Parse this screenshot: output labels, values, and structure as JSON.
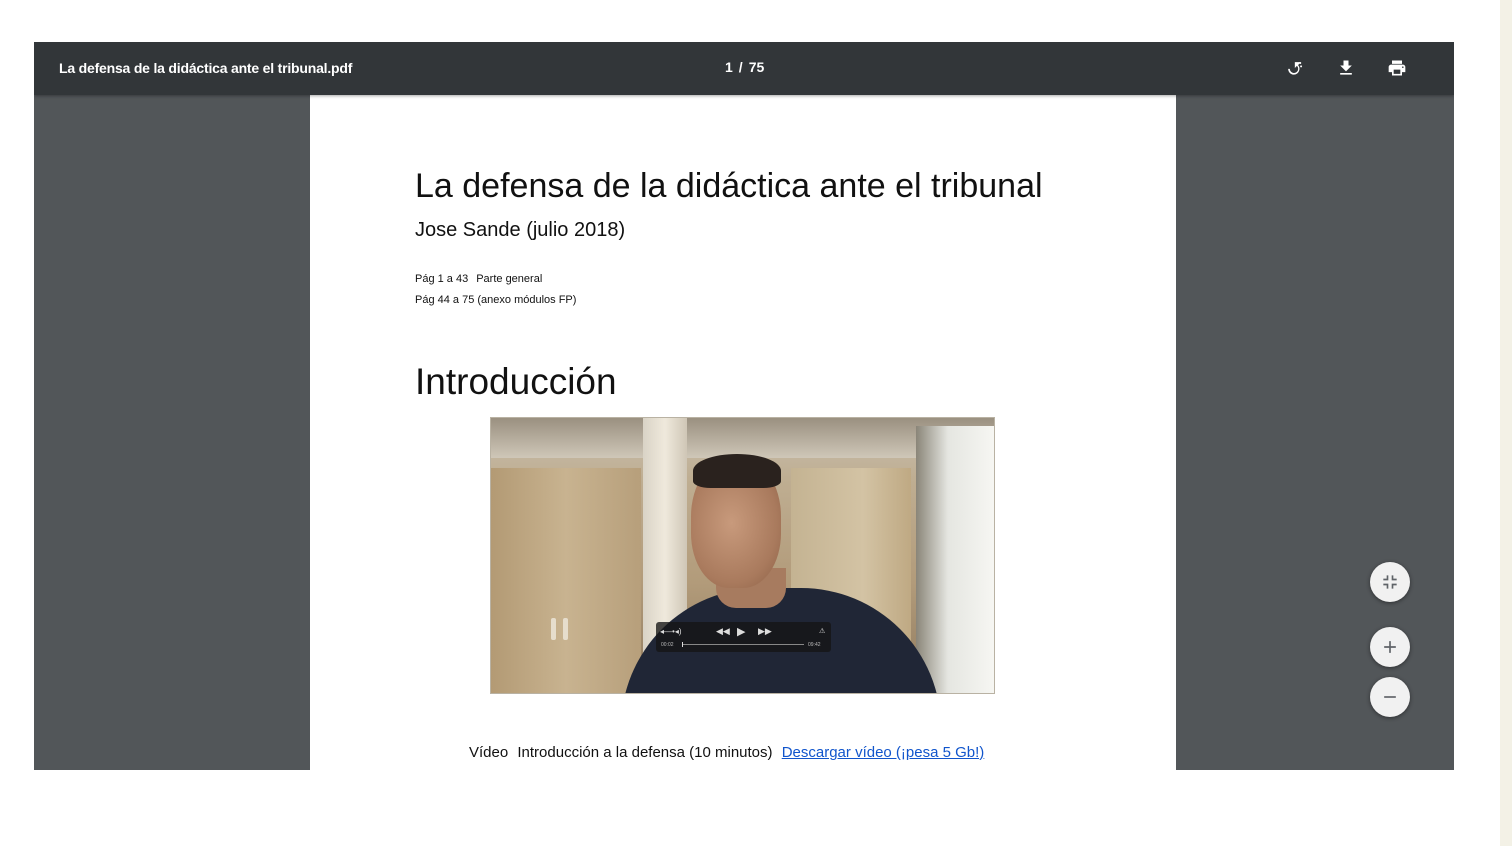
{
  "toolbar": {
    "title": "La defensa de la didáctica ante el tribunal.pdf",
    "page_current": "1",
    "page_separator": "/",
    "page_total": "75",
    "icons": [
      "rotate-icon",
      "download-icon",
      "print-icon"
    ]
  },
  "document": {
    "title": "La defensa de la didáctica ante el tribunal",
    "author": "Jose Sande (julio 2018)",
    "pages_line1_range": "Pág 1 a 43",
    "pages_line1_desc": "Parte general",
    "pages_line2": "Pág 44 a 75 (anexo módulos FP)",
    "section_heading": "Introducción",
    "caption_label": "Vídeo",
    "caption_text": "Introducción a la defensa (10 minutos)",
    "caption_link": "Descargar vídeo (¡pesa 5 Gb!)"
  },
  "video": {
    "time_current": "00:02",
    "time_end": "09:42",
    "progress": 0.0
  },
  "zoom_controls": {
    "icons": [
      "fit-to-page-icon",
      "zoom-in-icon",
      "zoom-out-icon"
    ]
  },
  "colors": {
    "toolbar": "#323639",
    "viewer_background": "#525659",
    "page": "#ffffff",
    "link": "#1155cc"
  }
}
